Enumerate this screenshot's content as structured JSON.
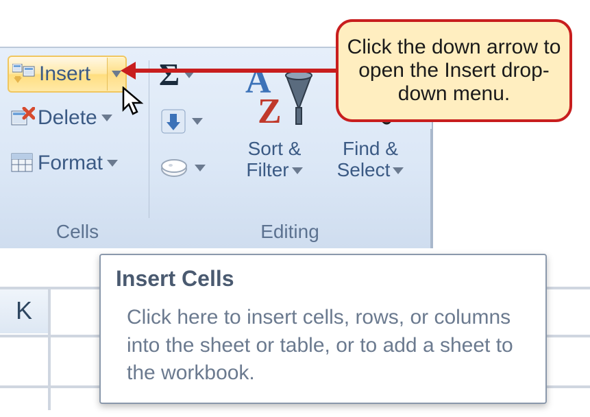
{
  "ribbon": {
    "cells_group": {
      "label": "Cells",
      "insert": {
        "label": "Insert"
      },
      "delete": {
        "label": "Delete"
      },
      "format": {
        "label": "Format"
      }
    },
    "editing_group": {
      "label": "Editing",
      "sort_filter": {
        "line1": "Sort &",
        "line2": "Filter"
      },
      "find_select": {
        "line1": "Find &",
        "line2": "Select"
      }
    }
  },
  "grid": {
    "column_k": "K"
  },
  "tooltip": {
    "title": "Insert Cells",
    "body": "Click here to insert cells, rows, or columns into the sheet or table, or to add a sheet to the workbook."
  },
  "callout": {
    "text": "Click the down arrow to open the Insert drop-down menu."
  }
}
